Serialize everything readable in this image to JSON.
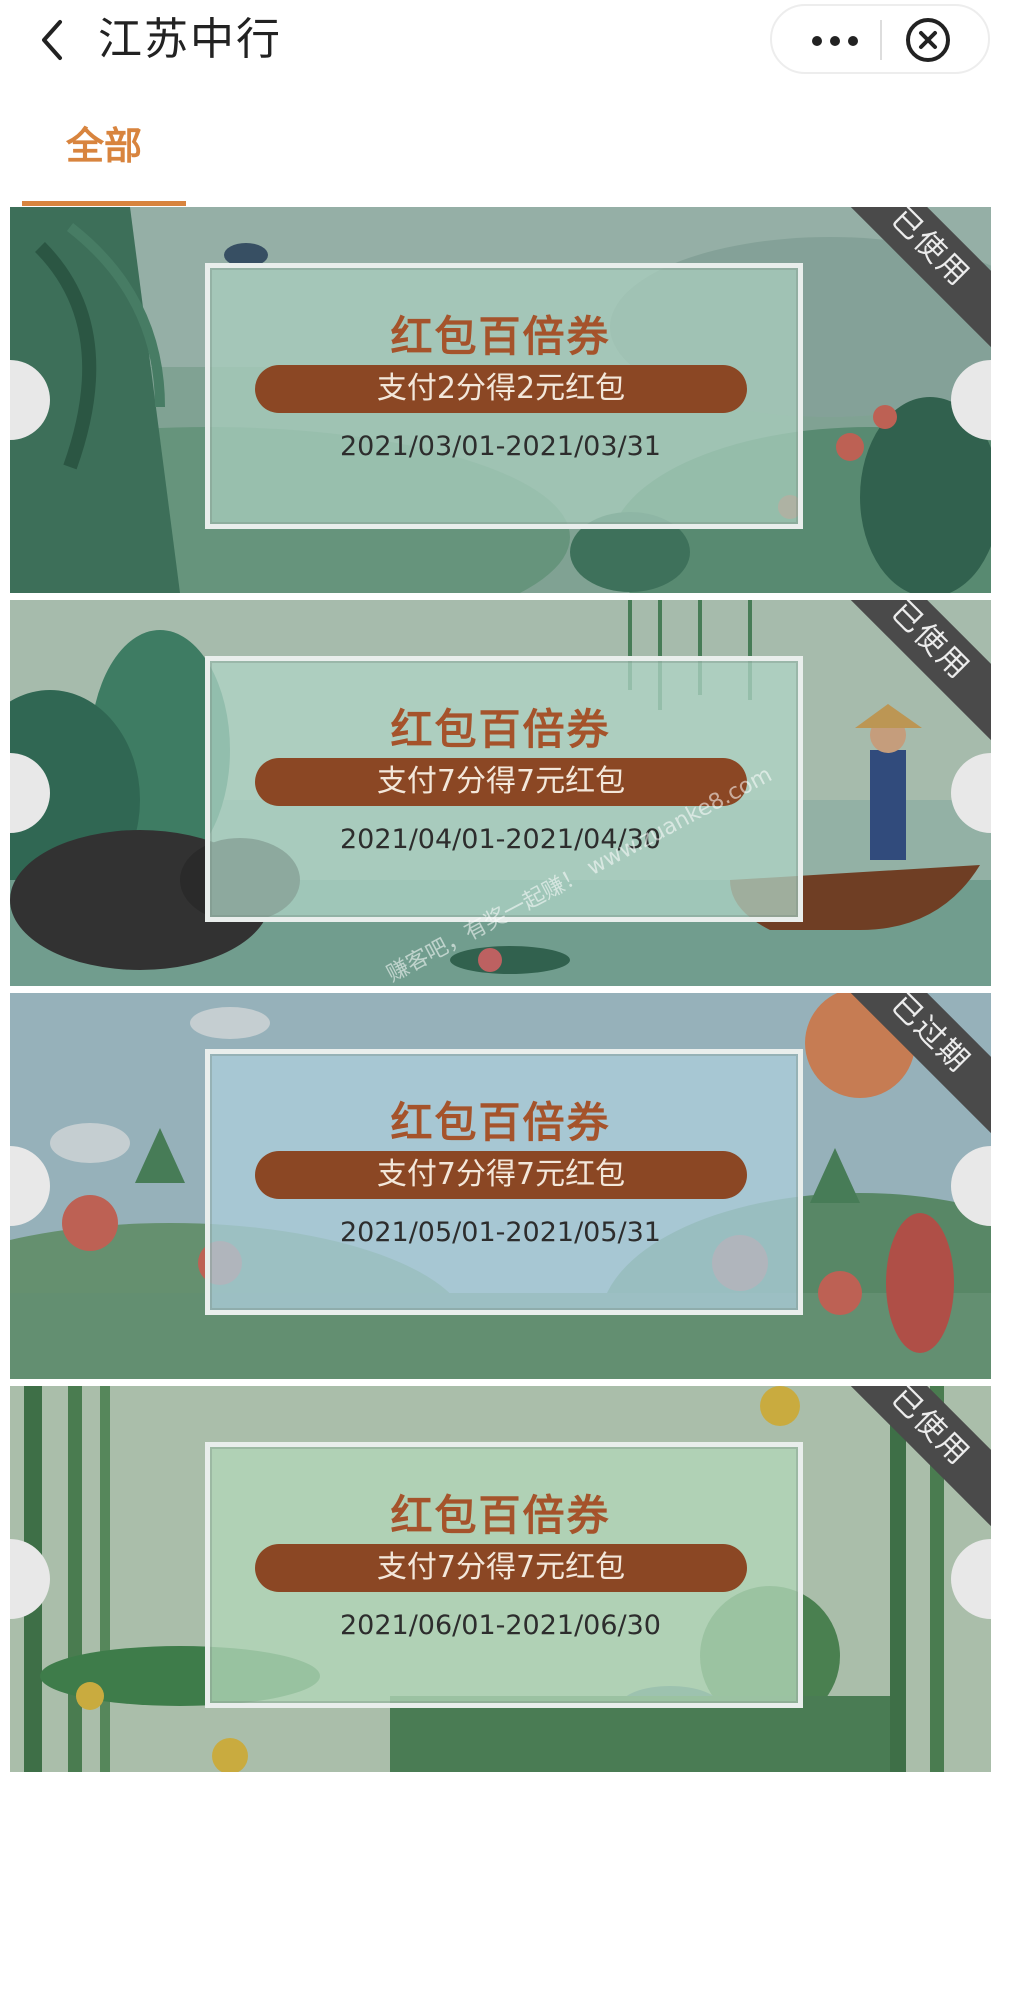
{
  "header": {
    "title": "江苏中行"
  },
  "tabs": [
    {
      "label": "全部",
      "active": true
    }
  ],
  "coupons": [
    {
      "title": "红包百倍券",
      "offer": "支付2分得2元红包",
      "date_range": "2021/03/01-2021/03/31",
      "status": "已使用",
      "theme_color": "#8fb9a6"
    },
    {
      "title": "红包百倍券",
      "offer": "支付7分得7元红包",
      "date_range": "2021/04/01-2021/04/30",
      "status": "已使用",
      "theme_color": "#8fbeb2"
    },
    {
      "title": "红包百倍券",
      "offer": "支付7分得7元红包",
      "date_range": "2021/05/01-2021/05/31",
      "status": "已过期",
      "theme_color": "#9cc3cf"
    },
    {
      "title": "红包百倍券",
      "offer": "支付7分得7元红包",
      "date_range": "2021/06/01-2021/06/30",
      "status": "已使用",
      "theme_color": "#9ccaa5"
    }
  ],
  "watermark": {
    "text": "赚客吧，有奖一起赚！ www.zuanke8.com"
  },
  "colors": {
    "accent": "#d8843e",
    "pill": "#8b4724",
    "title_text": "#a5532b",
    "ribbon": "#4a4a4a"
  }
}
